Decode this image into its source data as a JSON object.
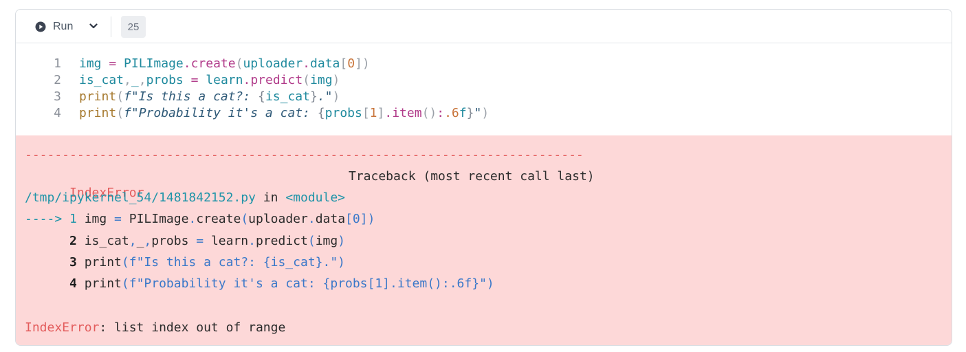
{
  "toolbar": {
    "run_label": "Run",
    "execution_count": "25"
  },
  "editor": {
    "line_numbers": [
      "1",
      "2",
      "3",
      "4"
    ],
    "lines": [
      {
        "tokens": [
          {
            "t": "img",
            "c": "var"
          },
          {
            "t": " ",
            "c": "plain"
          },
          {
            "t": "=",
            "c": "op"
          },
          {
            "t": " ",
            "c": "plain"
          },
          {
            "t": "PILImage",
            "c": "var"
          },
          {
            "t": ".",
            "c": "op"
          },
          {
            "t": "create",
            "c": "fn"
          },
          {
            "t": "(",
            "c": "punc"
          },
          {
            "t": "uploader",
            "c": "var"
          },
          {
            "t": ".",
            "c": "op"
          },
          {
            "t": "data",
            "c": "var"
          },
          {
            "t": "[",
            "c": "punc"
          },
          {
            "t": "0",
            "c": "num"
          },
          {
            "t": "]",
            "c": "punc"
          },
          {
            "t": ")",
            "c": "punc"
          }
        ]
      },
      {
        "tokens": [
          {
            "t": "is_cat",
            "c": "var"
          },
          {
            "t": ",",
            "c": "punc"
          },
          {
            "t": "_",
            "c": "var"
          },
          {
            "t": ",",
            "c": "punc"
          },
          {
            "t": "probs",
            "c": "var"
          },
          {
            "t": " ",
            "c": "plain"
          },
          {
            "t": "=",
            "c": "op"
          },
          {
            "t": " ",
            "c": "plain"
          },
          {
            "t": "learn",
            "c": "var"
          },
          {
            "t": ".",
            "c": "op"
          },
          {
            "t": "predict",
            "c": "fn"
          },
          {
            "t": "(",
            "c": "punc"
          },
          {
            "t": "img",
            "c": "var"
          },
          {
            "t": ")",
            "c": "punc"
          }
        ]
      },
      {
        "tokens": [
          {
            "t": "print",
            "c": "builtin"
          },
          {
            "t": "(",
            "c": "punc"
          },
          {
            "t": "f\"Is this a cat?: ",
            "c": "str"
          },
          {
            "t": "{",
            "c": "brace"
          },
          {
            "t": "is_cat",
            "c": "var"
          },
          {
            "t": "}",
            "c": "brace"
          },
          {
            "t": ".\"",
            "c": "str"
          },
          {
            "t": ")",
            "c": "punc"
          }
        ]
      },
      {
        "tokens": [
          {
            "t": "print",
            "c": "builtin"
          },
          {
            "t": "(",
            "c": "punc"
          },
          {
            "t": "f\"Probability it's a cat: ",
            "c": "str"
          },
          {
            "t": "{",
            "c": "brace"
          },
          {
            "t": "probs",
            "c": "var"
          },
          {
            "t": "[",
            "c": "punc"
          },
          {
            "t": "1",
            "c": "num"
          },
          {
            "t": "]",
            "c": "punc"
          },
          {
            "t": ".",
            "c": "op"
          },
          {
            "t": "item",
            "c": "fn"
          },
          {
            "t": "()",
            "c": "punc"
          },
          {
            "t": ":",
            "c": "op"
          },
          {
            "t": ".6",
            "c": "num"
          },
          {
            "t": "f",
            "c": "var"
          },
          {
            "t": "}",
            "c": "brace"
          },
          {
            "t": "\"",
            "c": "str"
          },
          {
            "t": ")",
            "c": "punc"
          }
        ]
      }
    ]
  },
  "output": {
    "separator": "---------------------------------------------------------------------------",
    "error_name": "IndexError",
    "traceback_header": "Traceback (most recent call last)",
    "file_path": "/tmp/ipykernel_54/1481842152.py",
    "in_word": "in",
    "module": "<module>",
    "tb_lines": [
      {
        "marker": "----> 1",
        "segments": [
          {
            "t": " img ",
            "c": "plain"
          },
          {
            "t": "=",
            "c": "blue"
          },
          {
            "t": " PILImage",
            "c": "plain"
          },
          {
            "t": ".",
            "c": "blue"
          },
          {
            "t": "create",
            "c": "plain"
          },
          {
            "t": "(",
            "c": "blue"
          },
          {
            "t": "uploader",
            "c": "plain"
          },
          {
            "t": ".",
            "c": "blue"
          },
          {
            "t": "data",
            "c": "plain"
          },
          {
            "t": "[",
            "c": "blue"
          },
          {
            "t": "0",
            "c": "blue"
          },
          {
            "t": "])",
            "c": "blue"
          }
        ]
      },
      {
        "marker": "2",
        "segments": [
          {
            "t": " is_cat",
            "c": "plain"
          },
          {
            "t": ",",
            "c": "blue"
          },
          {
            "t": "_",
            "c": "plain"
          },
          {
            "t": ",",
            "c": "blue"
          },
          {
            "t": "probs ",
            "c": "plain"
          },
          {
            "t": "=",
            "c": "blue"
          },
          {
            "t": " learn",
            "c": "plain"
          },
          {
            "t": ".",
            "c": "blue"
          },
          {
            "t": "predict",
            "c": "plain"
          },
          {
            "t": "(",
            "c": "blue"
          },
          {
            "t": "img",
            "c": "plain"
          },
          {
            "t": ")",
            "c": "blue"
          }
        ]
      },
      {
        "marker": "3",
        "segments": [
          {
            "t": " print",
            "c": "plain"
          },
          {
            "t": "(f\"Is this a cat?: {is_cat}.\")",
            "c": "blue"
          }
        ]
      },
      {
        "marker": "4",
        "segments": [
          {
            "t": " print",
            "c": "plain"
          },
          {
            "t": "(f\"Probability it's a cat: {probs[1].item():.6f}\")",
            "c": "blue"
          }
        ]
      }
    ],
    "final_error_name": "IndexError",
    "final_message": ": list index out of range"
  }
}
